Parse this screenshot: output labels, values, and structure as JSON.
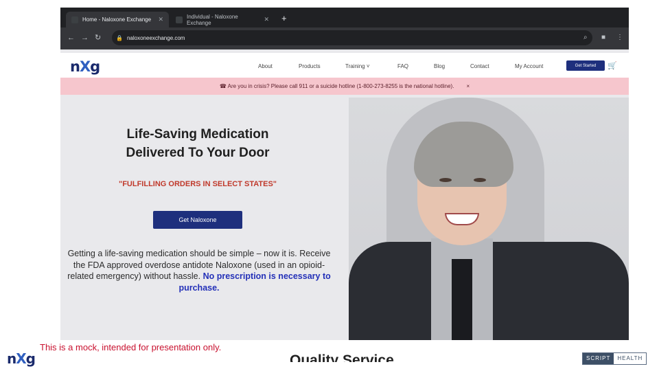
{
  "browser": {
    "tabs": [
      {
        "label": "Home - Naloxone Exchange",
        "active": true
      },
      {
        "label": "Individual - Naloxone Exchange",
        "active": false
      }
    ],
    "new_tab_icon": "+",
    "url": "naloxoneexchange.com"
  },
  "site": {
    "logo_text": "n",
    "logo_x": "X",
    "logo_g": "g",
    "nav": [
      "About",
      "Products",
      "Training ˅",
      "FAQ",
      "Blog",
      "Contact",
      "My Account"
    ],
    "cta_label": "Get Started",
    "banner": "☎ Are you in crisis? Please call 911 or a suicide hotline (1-800-273-8255 is the national hotline).",
    "banner_close": "×",
    "headline_line1": "Life-Saving Medication",
    "headline_line2": "Delivered To Your Door",
    "subhead": "\"FULFILLING ORDERS IN SELECT STATES\"",
    "button_label": "Get Naloxone",
    "desc_plain": "Getting a life-saving medication should be simple – now it is. Receive the FDA approved overdose antidote Naloxone (used in an opioid-related emergency) without hassle. ",
    "desc_highlight": "No prescription is necessary to purchase.",
    "next_section": "Quality Service"
  },
  "slide": {
    "disclaimer": "This is a mock, intended for presentation only.",
    "brand_left": "n",
    "brand_left_x": "X",
    "brand_left_g": "g",
    "brand_right_a": "SCRIPT",
    "brand_right_b": "HEALTH"
  },
  "colors": {
    "accent": "#1e2f7d",
    "banner": "#f6c6cd",
    "warning_text": "#c0392b",
    "disclaimer": "#c8102e"
  }
}
